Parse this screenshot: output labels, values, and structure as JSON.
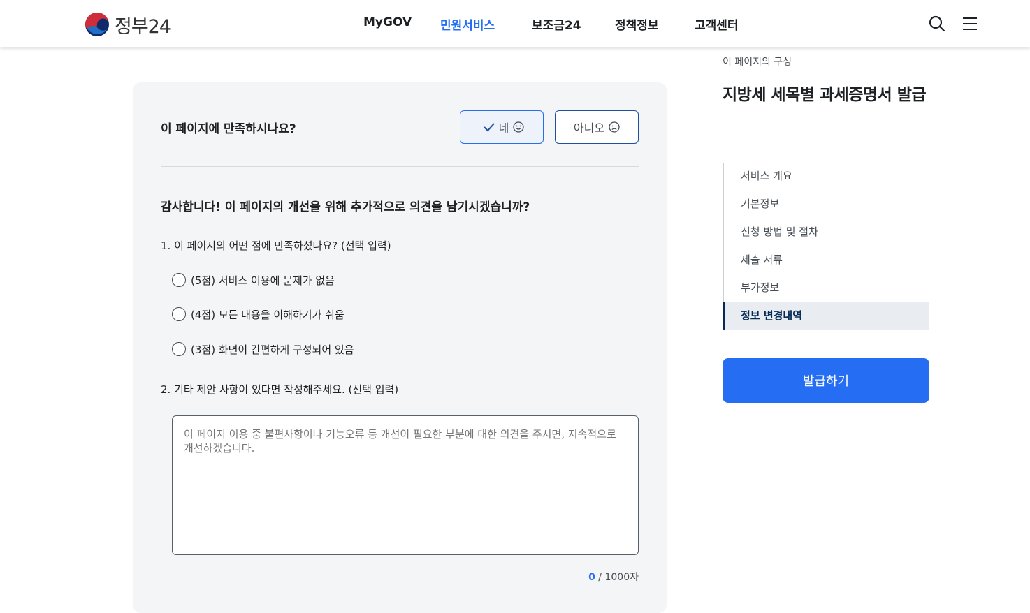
{
  "header": {
    "logo_text": "정부24",
    "logo_icon": "taegeuk-logo-icon",
    "nav": [
      {
        "label": "MyGOV",
        "active": false
      },
      {
        "label": "민원서비스",
        "active": true
      },
      {
        "label": "보조금24",
        "active": false
      },
      {
        "label": "정책정보",
        "active": false
      },
      {
        "label": "고객센터",
        "active": false
      }
    ],
    "search_icon": "search-icon",
    "menu_icon": "menu-icon",
    "accent_color": "#256ef4"
  },
  "feedback": {
    "question": "이 페이지에 만족하시나요?",
    "yes_label": "네",
    "no_label": "아니오",
    "thanks": "감사합니다! 이 페이지의 개선을 위해 추가적으로 의견을 남기시겠습니까?",
    "q1": "1. 이 페이지의 어떤 점에 만족하셨나요? (선택 입력)",
    "options": [
      "(5점) 서비스 이용에 문제가 없음",
      "(4점) 모든 내용을 이해하기가 쉬움",
      "(3점) 화면이 간편하게 구성되어 있음"
    ],
    "q2": "2. 기타 제안 사항이 있다면 작성해주세요. (선택 입력)",
    "textarea_placeholder": "이 페이지 이용 중 불편사항이나 기능오류 등 개선이 필요한 부분에 대한 의견을 주시면, 지속적으로 개선하겠습니다.",
    "counter_current": "0",
    "counter_max": " / 1000자"
  },
  "side": {
    "caption": "이 페이지의 구성",
    "title": "지방세 세목별 과세증명서 발급",
    "toc": [
      {
        "label": "서비스 개요",
        "active": false
      },
      {
        "label": "기본정보",
        "active": false
      },
      {
        "label": "신청 방법 및 절차",
        "active": false
      },
      {
        "label": "제출 서류",
        "active": false
      },
      {
        "label": "부가정보",
        "active": false
      },
      {
        "label": "정보 변경내역",
        "active": true
      }
    ],
    "issue_button": "발급하기"
  }
}
